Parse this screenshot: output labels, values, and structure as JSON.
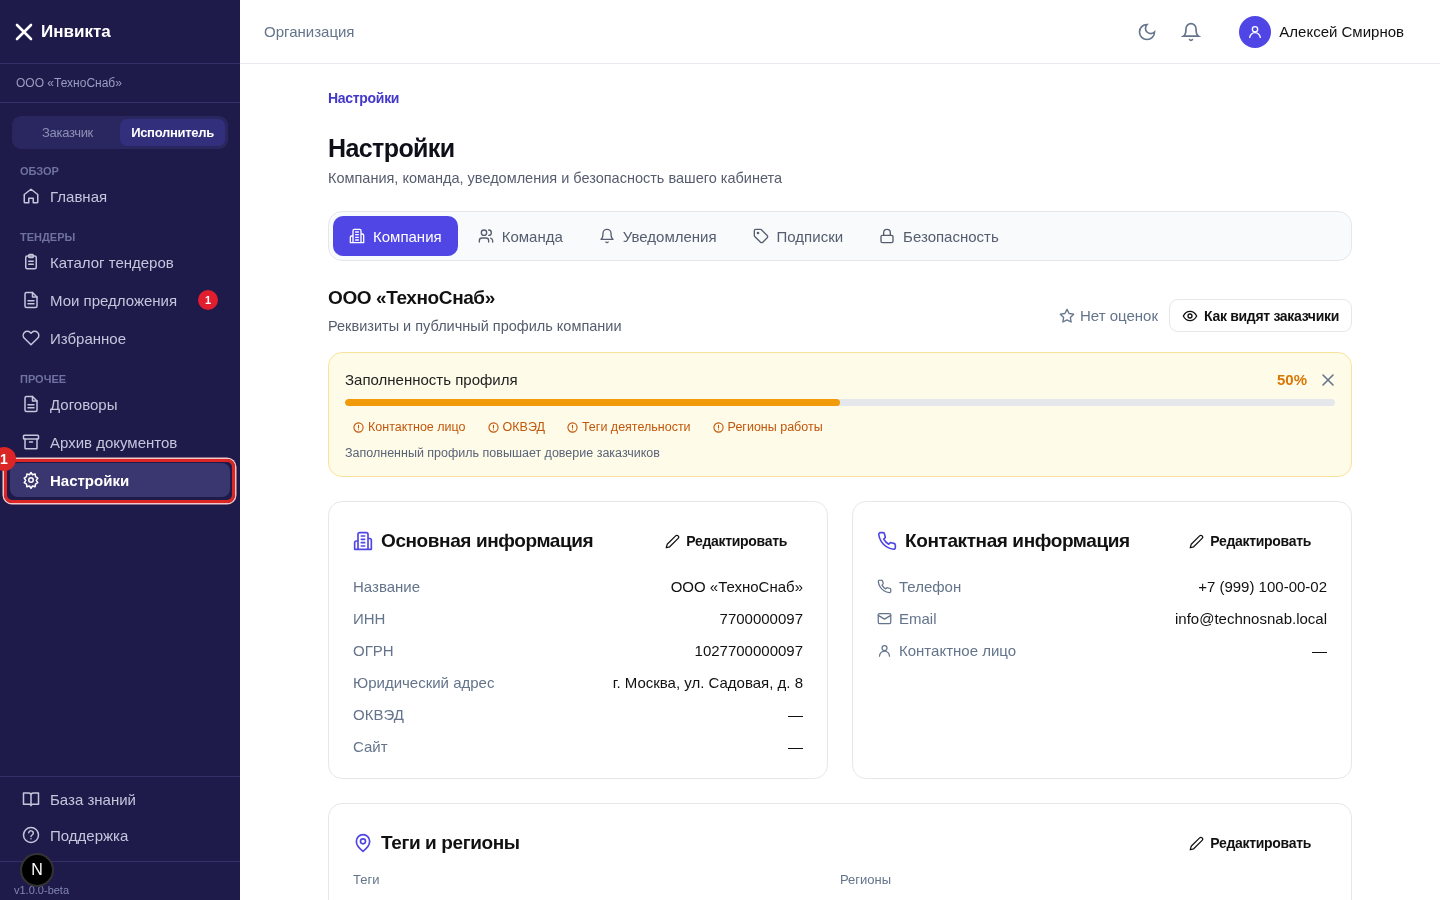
{
  "brand": {
    "name": "Инвикта"
  },
  "organization": "ООО «ТехноСнаб»",
  "role_switch": [
    {
      "label": "Заказчик",
      "selected": false
    },
    {
      "label": "Исполнитель",
      "selected": true
    }
  ],
  "nav_sections": [
    {
      "title": "ОБЗОР",
      "items": [
        {
          "label": "Главная",
          "selected": false
        }
      ]
    },
    {
      "title": "ТЕНДЕРЫ",
      "items": [
        {
          "label": "Каталог тендеров",
          "selected": false
        },
        {
          "label": "Мои предложения",
          "selected": false,
          "badge": "1"
        },
        {
          "label": "Избранное",
          "selected": false
        }
      ]
    },
    {
      "title": "ПРОЧЕЕ",
      "items": [
        {
          "label": "Договоры",
          "selected": false
        },
        {
          "label": "Архив документов",
          "selected": false
        },
        {
          "label": "Настройки",
          "selected": true,
          "annotation": "1"
        }
      ]
    }
  ],
  "nav_footer": [
    {
      "label": "База знаний"
    },
    {
      "label": "Поддержка"
    }
  ],
  "dev_indicator": "N",
  "version": "v1.0.0-beta",
  "topbar": {
    "section": "Организация",
    "user": "Алексей Смирнов"
  },
  "breadcrumb": "Настройки",
  "title": "Настройки",
  "subtitle": "Компания, команда, уведомления и безопасность вашего кабинета",
  "tabs": [
    {
      "label": "Компания",
      "selected": true
    },
    {
      "label": "Команда",
      "selected": false
    },
    {
      "label": "Уведомления",
      "selected": false
    },
    {
      "label": "Подписки",
      "selected": false
    },
    {
      "label": "Безопасность",
      "selected": false
    }
  ],
  "company": {
    "name": "ООО «ТехноСнаб»",
    "description": "Реквизиты и публичный профиль компании",
    "rating": "Нет оценок",
    "preview_button": "Как видят заказчики"
  },
  "completeness": {
    "title": "Заполненность профиля",
    "percent": "50%",
    "level": 0.5,
    "missing": [
      "Контактное лицо",
      "ОКВЭД",
      "Теги деятельности",
      "Регионы работы"
    ],
    "hint": "Заполненный профиль повышает доверие заказчиков"
  },
  "cards": [
    {
      "title": "Основная информация",
      "edit": "Редактировать",
      "fields": [
        {
          "label": "Название",
          "value": "ООО «ТехноСнаб»"
        },
        {
          "label": "ИНН",
          "value": "7700000097"
        },
        {
          "label": "ОГРН",
          "value": "1027700000097"
        },
        {
          "label": "Юридический адрес",
          "value": "г. Москва, ул. Садовая, д. 8"
        },
        {
          "label": "ОКВЭД",
          "value": "—"
        },
        {
          "label": "Сайт",
          "value": "—"
        }
      ]
    },
    {
      "title": "Контактная информация",
      "edit": "Редактировать",
      "fields": [
        {
          "label": "Телефон",
          "value": "+7 (999) 100-00-02"
        },
        {
          "label": "Email",
          "value": "info@technosnab.local"
        },
        {
          "label": "Контактное лицо",
          "value": "—"
        }
      ]
    }
  ],
  "tags_card": {
    "title": "Теги и регионы",
    "edit": "Редактировать",
    "columns": [
      "Теги",
      "Регионы"
    ]
  }
}
